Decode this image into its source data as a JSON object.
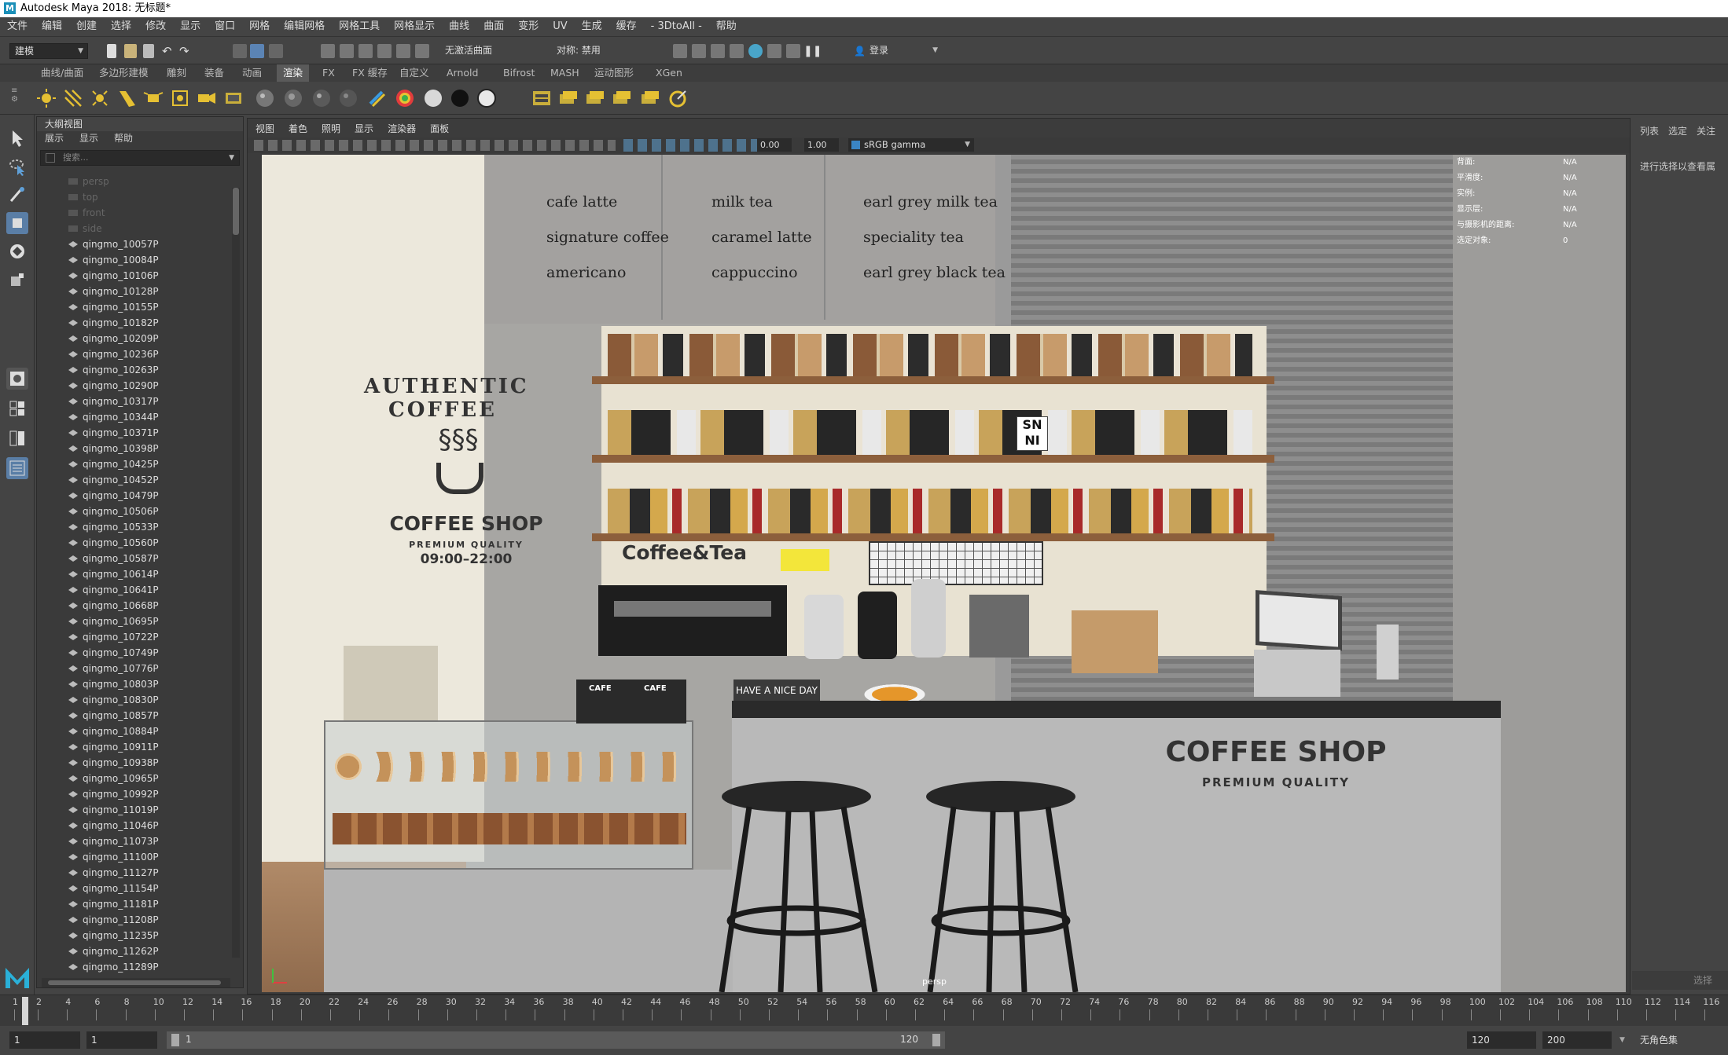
{
  "window": {
    "title": "Autodesk Maya 2018: 无标题*"
  },
  "menubar": [
    "文件",
    "编辑",
    "创建",
    "选择",
    "修改",
    "显示",
    "窗口",
    "网格",
    "编辑网格",
    "网格工具",
    "网格显示",
    "曲线",
    "曲面",
    "变形",
    "UV",
    "生成",
    "缓存",
    "- 3DtoAll -",
    "帮助"
  ],
  "statusline": {
    "mode": "建模",
    "live_surface": "无激活曲面",
    "symmetry": "对称: 禁用",
    "login": "登录"
  },
  "shelf_tabs": [
    "曲线/曲面",
    "多边形建模",
    "雕刻",
    "装备",
    "动画",
    "渲染",
    "FX",
    "FX 缓存",
    "自定义",
    "Arnold",
    "Bifrost",
    "MASH",
    "运动图形",
    "XGen"
  ],
  "active_shelf_tab": "渲染",
  "outliner": {
    "title": "大纲视图",
    "menu": [
      "展示",
      "显示",
      "帮助"
    ],
    "search_placeholder": "搜索...",
    "cameras": [
      "persp",
      "top",
      "front",
      "side"
    ],
    "items": [
      "qingmo_10057P",
      "qingmo_10084P",
      "qingmo_10106P",
      "qingmo_10128P",
      "qingmo_10155P",
      "qingmo_10182P",
      "qingmo_10209P",
      "qingmo_10236P",
      "qingmo_10263P",
      "qingmo_10290P",
      "qingmo_10317P",
      "qingmo_10344P",
      "qingmo_10371P",
      "qingmo_10398P",
      "qingmo_10425P",
      "qingmo_10452P",
      "qingmo_10479P",
      "qingmo_10506P",
      "qingmo_10533P",
      "qingmo_10560P",
      "qingmo_10587P",
      "qingmo_10614P",
      "qingmo_10641P",
      "qingmo_10668P",
      "qingmo_10695P",
      "qingmo_10722P",
      "qingmo_10749P",
      "qingmo_10776P",
      "qingmo_10803P",
      "qingmo_10830P",
      "qingmo_10857P",
      "qingmo_10884P",
      "qingmo_10911P",
      "qingmo_10938P",
      "qingmo_10965P",
      "qingmo_10992P",
      "qingmo_11019P",
      "qingmo_11046P",
      "qingmo_11073P",
      "qingmo_11100P",
      "qingmo_11127P",
      "qingmo_11154P",
      "qingmo_11181P",
      "qingmo_11208P",
      "qingmo_11235P",
      "qingmo_11262P",
      "qingmo_11289P"
    ]
  },
  "viewport": {
    "menu": [
      "视图",
      "着色",
      "照明",
      "显示",
      "渲染器",
      "面板"
    ],
    "exposure": "0.00",
    "gamma_value": "1.00",
    "color_space": "sRGB gamma",
    "camera_label": "persp",
    "hud": [
      {
        "label": "背面:",
        "value": "N/A"
      },
      {
        "label": "平滑度:",
        "value": "N/A"
      },
      {
        "label": "实例:",
        "value": "N/A"
      },
      {
        "label": "显示层:",
        "value": "N/A"
      },
      {
        "label": "与摄影机的距离:",
        "value": "N/A"
      },
      {
        "label": "选定对象:",
        "value": "0"
      }
    ]
  },
  "scene": {
    "menu_col1": [
      "cafe latte",
      "signature coffee",
      "americano"
    ],
    "menu_col2": [
      "milk tea",
      "caramel latte",
      "cappuccino"
    ],
    "menu_col3": [
      "earl grey milk tea",
      "speciality tea",
      "earl grey black tea"
    ],
    "wall_logo_arc": "AUTHENTIC COFFEE",
    "wall_logo_title": "COFFEE SHOP",
    "wall_logo_sub": "PREMIUM QUALITY",
    "wall_hours": "09:00–22:00",
    "shelf_sign": "Coffee&Tea",
    "counter_title": "COFFEE SHOP",
    "counter_sub": "PREMIUM QUALITY",
    "card_text": "HAVE A NICE DAY",
    "bag_label": "CAFE",
    "tin_letters": [
      "S",
      "N",
      "N",
      "I"
    ]
  },
  "right_panel": {
    "tabs": [
      "列表",
      "选定",
      "关注"
    ],
    "hint": "进行选择以查看属",
    "footer": "选择"
  },
  "timeline": {
    "ticks": [
      "1",
      "2",
      "4",
      "6",
      "8",
      "10",
      "12",
      "14",
      "16",
      "18",
      "20",
      "22",
      "24",
      "26",
      "28",
      "30",
      "32",
      "34",
      "36",
      "38",
      "40",
      "42",
      "44",
      "46",
      "48",
      "50",
      "52",
      "54",
      "56",
      "58",
      "60",
      "62",
      "64",
      "66",
      "68",
      "70",
      "72",
      "74",
      "76",
      "78",
      "80",
      "82",
      "84",
      "86",
      "88",
      "90",
      "92",
      "94",
      "96",
      "98",
      "100",
      "102",
      "104",
      "106",
      "108",
      "110",
      "112",
      "114",
      "116"
    ]
  },
  "range": {
    "start": "1",
    "current": "1",
    "slider_start": "1",
    "slider_end": "120",
    "end": "120",
    "max": "200",
    "char_set": "无角色集"
  }
}
